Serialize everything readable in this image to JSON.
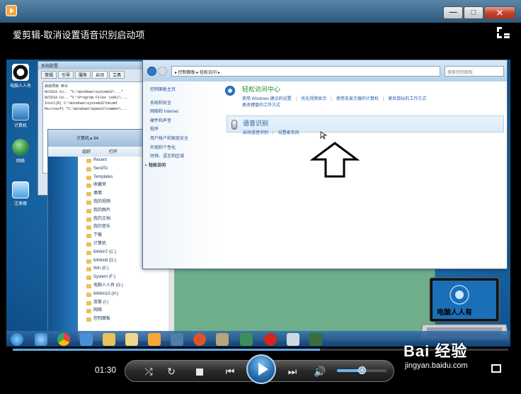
{
  "window": {
    "title": "爱剪辑-取消设置语音识别启动项",
    "buttons": {
      "minimize": "—",
      "maximize": "□",
      "close": "✕"
    }
  },
  "video": {
    "desktop_icons": [
      "电脑人人有",
      "计算机",
      "网络",
      "注册器"
    ],
    "sysinfo": {
      "title": "系统配置",
      "tabs": [
        "常规",
        "引导",
        "服务",
        "启动",
        "工具"
      ],
      "rows": [
        "启动项目     命令",
        "NVIDIA Co.. \"C:\\Windows\\system32\\...\"",
        "NVIDIA Co.. \"C:\\Program Files (x86)\\...",
        "Intel(R)   C:\\Windows\\system32\\hkcmd",
        "Microsoft  \"C:\\Windows\\Speech\\Common\\..."
      ]
    },
    "explorer": {
      "toolbar": [
        "组织",
        "打开"
      ],
      "address": "计算机 ▸ 64",
      "nav": [
        "Recent",
        "SendTo",
        "Templates",
        "收藏夹",
        "桌面",
        "我的视频",
        "我的图片",
        "我的文档",
        "我的音乐",
        "下载",
        "计算机",
        "64Win7 (C:)",
        "64Win8 (D:)",
        "Win (E:)",
        "System (F:)",
        "电脑人人有 (G:)",
        "64Win10 (H:)",
        "双拳 (I:)",
        "网络",
        "控制面板"
      ]
    },
    "control_panel": {
      "address": "▸ 控制面板 ▸ 轻松访问 ▸",
      "search_placeholder": "搜索控制面板",
      "sidebar": [
        "控制面板主页",
        "系统和安全",
        "网络和 Internet",
        "硬件和声音",
        "程序",
        "用户帐户和家庭安全",
        "外观和个性化",
        "时钟、语言和区域",
        "轻松访问"
      ],
      "ease_center": {
        "title": "轻松访问中心",
        "links": [
          "使用 Windows 建议的设置",
          "优化视频显示",
          "使用无显示器的计算机",
          "更改鼠标的工作方式",
          "更改键盘的工作方式"
        ]
      },
      "speech": {
        "title": "语音识别",
        "links": [
          "启动语音识别",
          "设置麦克风"
        ]
      }
    },
    "logo_card": {
      "caption": "电脑人人有"
    }
  },
  "player": {
    "elapsed": "01:30",
    "progress": 0.62,
    "volume": 0.5
  },
  "watermark": {
    "brand": "Bai 经验",
    "url": "jingyan.baidu.com"
  },
  "colors": {
    "accent": "#3e6a8d",
    "play": "#2b6fb3",
    "link": "#1f5aa8",
    "green": "#1c8a2c"
  }
}
